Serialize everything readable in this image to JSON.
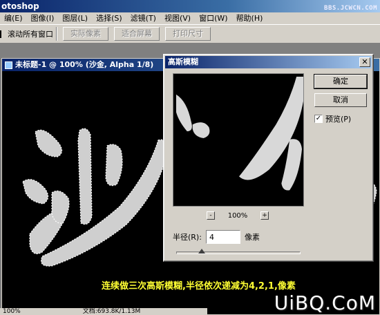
{
  "app": {
    "title": "otoshop",
    "watermark": "BBS.JCWCN.COM"
  },
  "menu": {
    "items": [
      "编(E)",
      "图像(I)",
      "图层(L)",
      "选择(S)",
      "滤镜(T)",
      "视图(V)",
      "窗口(W)",
      "帮助(H)"
    ]
  },
  "options": {
    "scroll_all_label": "滚动所有窗口",
    "actual_pixels": "实际像素",
    "fit_screen": "适合屏幕",
    "print_size": "打印尺寸"
  },
  "document": {
    "title": "未标题-1 @ 100% (沙金, Alpha 1/8)",
    "caption": "连续做三次高斯模糊,半径依次递减为4,2,1,像素",
    "status_zoom": "100%",
    "status_doc": "文档:693.8K/1.13M",
    "watermark": "UiBQ.CoM"
  },
  "dialog": {
    "title": "高斯模糊",
    "ok": "确定",
    "cancel": "取消",
    "preview_label": "预览(P)",
    "preview_checked": true,
    "zoom_minus": "-",
    "zoom_plus": "+",
    "zoom_value": "100%",
    "radius_label": "半径(R):",
    "radius_value": "4",
    "radius_unit": "像素",
    "slider_fraction": 0.2
  }
}
